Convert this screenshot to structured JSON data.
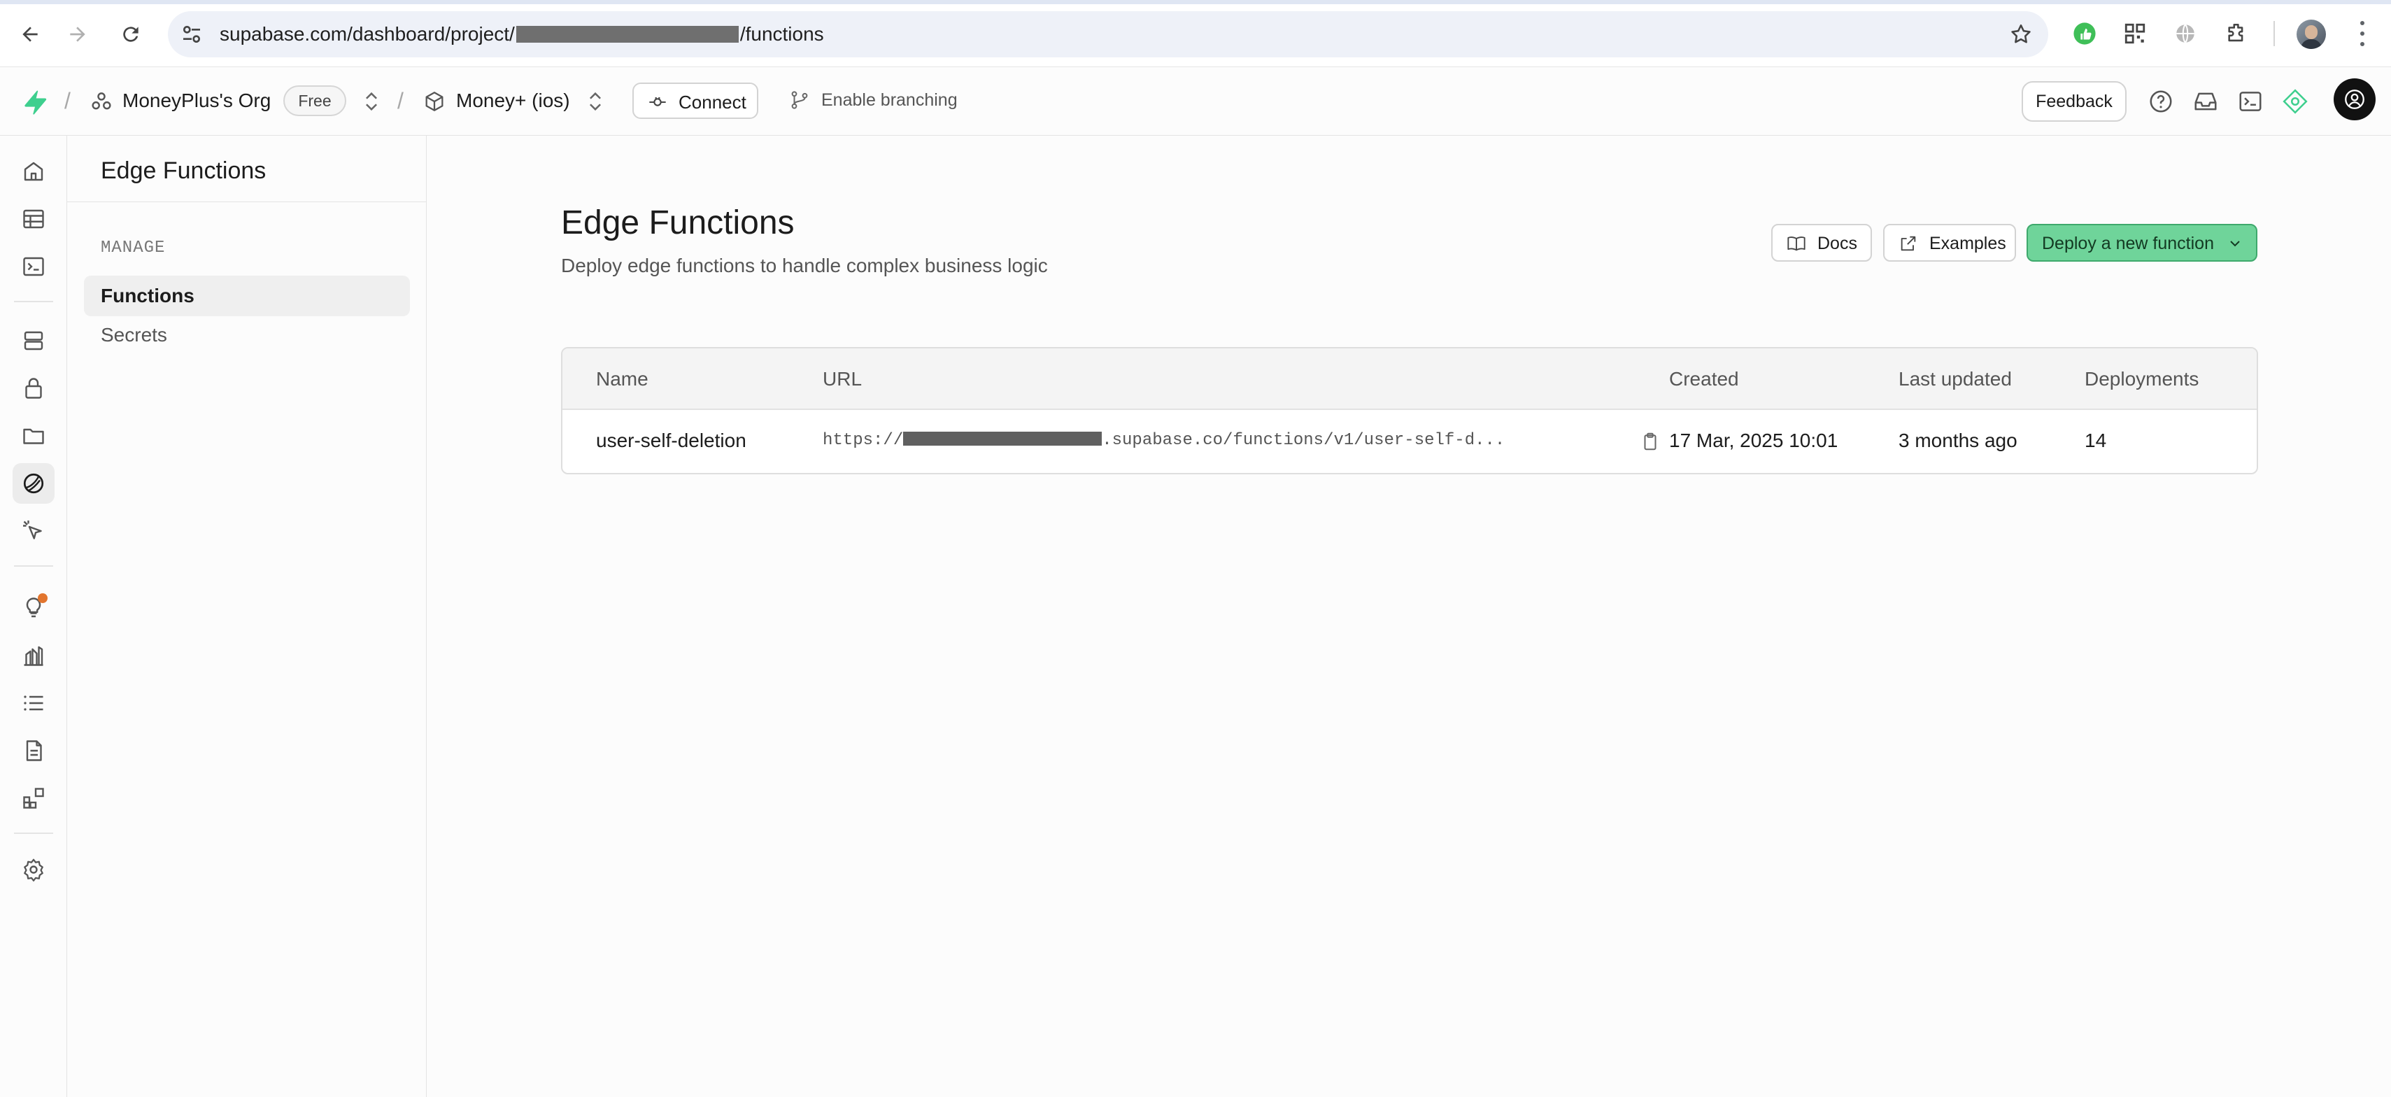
{
  "browser": {
    "url_prefix": "supabase.com/dashboard/project/",
    "url_suffix": "/functions"
  },
  "header": {
    "org_name": "MoneyPlus's Org",
    "plan_badge": "Free",
    "project_name": "Money+ (ios)",
    "connect_label": "Connect",
    "branching_label": "Enable branching",
    "feedback_label": "Feedback"
  },
  "sidebar": {
    "title": "Edge Functions",
    "section_label": "MANAGE",
    "items": [
      {
        "label": "Functions",
        "active": true
      },
      {
        "label": "Secrets",
        "active": false
      }
    ]
  },
  "main": {
    "title": "Edge Functions",
    "subtitle": "Deploy edge functions to handle complex business logic",
    "docs_label": "Docs",
    "examples_label": "Examples",
    "deploy_label": "Deploy a new function",
    "table": {
      "headers": [
        "Name",
        "URL",
        "Created",
        "Last updated",
        "Deployments"
      ],
      "rows": [
        {
          "name": "user-self-deletion",
          "url_prefix": "https://",
          "url_suffix": ".supabase.co/functions/v1/user-self-d...",
          "created": "17 Mar, 2025 10:01",
          "last_updated": "3 months ago",
          "deployments": "14"
        }
      ]
    }
  },
  "colors": {
    "brand_green": "#3ecf8e",
    "deploy_button": "#6fd49a",
    "notification_dot": "#e2752e"
  }
}
